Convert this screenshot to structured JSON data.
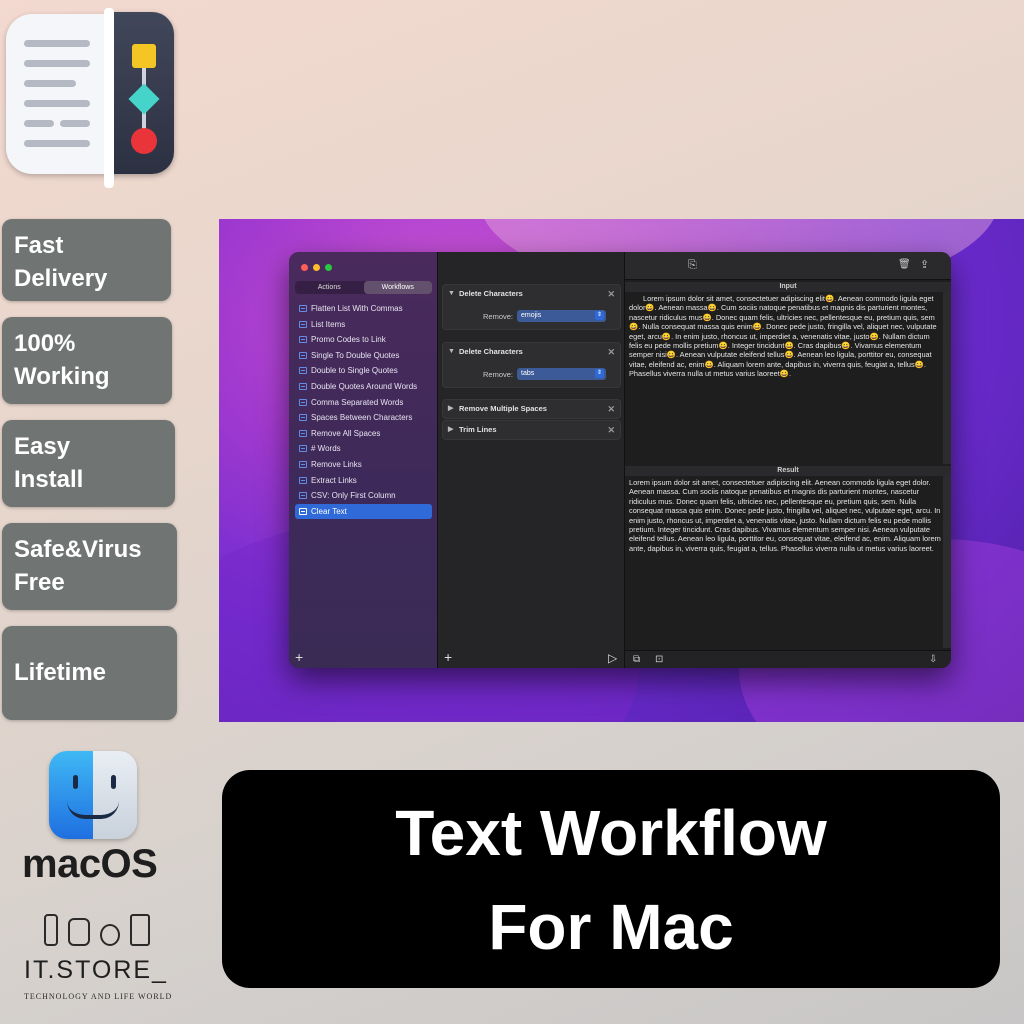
{
  "badges": [
    {
      "label": "Fast\nDelivery"
    },
    {
      "label": "100%\nWorking"
    },
    {
      "label": "Easy\nInstall"
    },
    {
      "label": "Safe&Virus\nFree"
    },
    {
      "label": "Lifetime"
    }
  ],
  "brand": {
    "os_label": "macOS",
    "store_name": "IT.STORE_",
    "store_tagline": "TECHNOLOGY AND LIFE WORLD"
  },
  "title": {
    "line1": "Text Workflow",
    "line2": "For Mac"
  },
  "app": {
    "tabs": [
      {
        "label": "Actions",
        "active": false
      },
      {
        "label": "Workflows",
        "active": true
      }
    ],
    "workflows": [
      "Flatten List With Commas",
      "List Items",
      "Promo Codes to Link",
      "Single To Double Quotes",
      "Double to Single Quotes",
      "Double Quotes Around Words",
      "Comma Separated Words",
      "Spaces Between Characters",
      "Remove All Spaces",
      "# Words",
      "Remove Links",
      "Extract Links",
      "CSV: Only First Column",
      "Clear Text"
    ],
    "selected_workflow": "Clear Text",
    "actions": [
      {
        "title": "Delete Characters",
        "expanded": true,
        "field_label": "Remove:",
        "value": "emojis"
      },
      {
        "title": "Delete Characters",
        "expanded": true,
        "field_label": "Remove:",
        "value": "tabs"
      },
      {
        "title": "Remove Multiple Spaces",
        "expanded": false
      },
      {
        "title": "Trim Lines",
        "expanded": false
      }
    ],
    "input_label": "Input",
    "result_label": "Result",
    "input_text": "Lorem ipsum dolor sit amet, consectetuer adipiscing elit😀. Aenean commodo ligula eget dolor😀. Aenean massa😀. Cum sociis natoque penatibus et magnis dis parturient montes, nascetur ridiculus mus😀. Donec quam felis, ultricies nec, pellentesque eu, pretium quis, sem😀. Nulla consequat massa quis enim😀. Donec pede justo, fringilla vel, aliquet nec, vulputate eget, arcu😀. In enim justo, rhoncus ut, imperdiet a, venenatis vitae, justo😀. Nullam dictum felis eu pede mollis pretium😀. Integer tincidunt😀. Cras dapibus😀. Vivamus elementum semper nisi😀. Aenean vulputate eleifend tellus😀. Aenean leo ligula, porttitor eu, consequat vitae, eleifend ac, enim😀. Aliquam lorem ante, dapibus in, viverra quis, feugiat a, tellus😀. Phasellus viverra nulla ut metus varius laoreet😀.",
    "result_text": "Lorem ipsum dolor sit amet, consectetuer adipiscing elit. Aenean commodo ligula eget dolor. Aenean massa. Cum sociis natoque penatibus et magnis dis parturient montes, nascetur ridiculus mus. Donec quam felis, ultricies nec, pellentesque eu, pretium quis, sem. Nulla consequat massa quis enim. Donec pede justo, fringilla vel, aliquet nec, vulputate eget, arcu. In enim justo, rhoncus ut, imperdiet a, venenatis vitae, justo. Nullam dictum felis eu pede mollis pretium. Integer tincidunt. Cras dapibus. Vivamus elementum semper nisi. Aenean vulputate eleifend tellus. Aenean leo ligula, porttitor eu, consequat vitae, eleifend ac, enim. Aliquam lorem ante, dapibus in, viverra quis, feugiat a, tellus. Phasellus viverra nulla ut metus varius laoreet.",
    "icons": {
      "sidebar_toggle": "▭",
      "play_menu": "▶",
      "clipboard": "⎘",
      "trash": "🗑",
      "share": "⇪",
      "add": "+",
      "run": "▷",
      "copy": "⧉",
      "paste": "⊡",
      "export": "⇩"
    }
  },
  "colors": {
    "badge_bg": "#707473",
    "accent_blue": "#2f6ad8",
    "title_bg": "#000000"
  }
}
